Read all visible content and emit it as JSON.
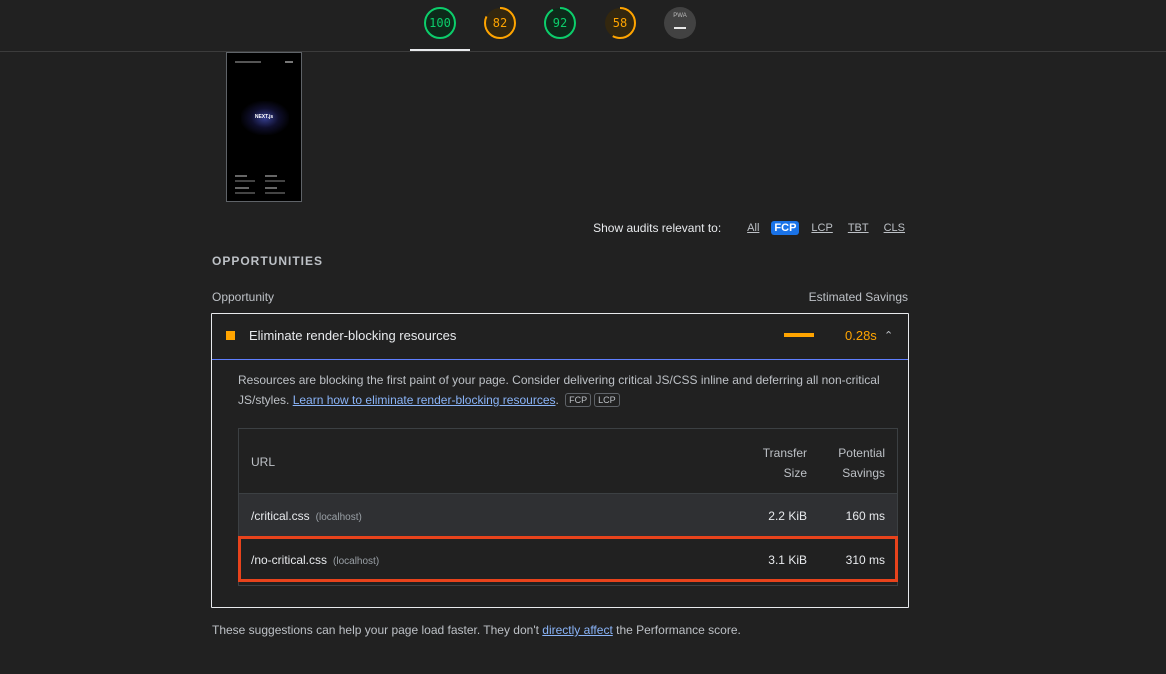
{
  "scores": [
    {
      "value": "100",
      "color": "#0cce6b",
      "percent": 100
    },
    {
      "value": "82",
      "color": "#ffa400",
      "percent": 82
    },
    {
      "value": "92",
      "color": "#0cce6b",
      "percent": 92
    },
    {
      "value": "58",
      "color": "#ffa400",
      "percent": 58
    },
    {
      "value": "PWA",
      "color": "#e8e8e8",
      "percent": 0
    }
  ],
  "thumbnail": {
    "logo_text": "NEXT.js"
  },
  "filter": {
    "label": "Show audits relevant to:",
    "options": [
      "All",
      "FCP",
      "LCP",
      "TBT",
      "CLS"
    ],
    "selected": "FCP"
  },
  "section": {
    "title": "OPPORTUNITIES",
    "col_opportunity": "Opportunity",
    "col_savings": "Estimated Savings"
  },
  "audit": {
    "title": "Eliminate render-blocking resources",
    "savings": "0.28s",
    "description": "Resources are blocking the first paint of your page. Consider delivering critical JS/CSS inline and deferring all non-critical JS/styles. ",
    "link_text": "Learn how to eliminate render-blocking resources",
    "tags": [
      "FCP",
      "LCP"
    ],
    "accent": "#ffa400",
    "table": {
      "headers": {
        "url": "URL",
        "transfer_1": "Transfer",
        "transfer_2": "Size",
        "savings_1": "Potential",
        "savings_2": "Savings"
      },
      "rows": [
        {
          "url": "/critical.css",
          "host": "(localhost)",
          "size": "2.2 KiB",
          "savings": "160 ms"
        },
        {
          "url": "/no-critical.css",
          "host": "(localhost)",
          "size": "3.1 KiB",
          "savings": "310 ms"
        }
      ]
    }
  },
  "footer": {
    "before": "These suggestions can help your page load faster. They don't ",
    "link": "directly affect",
    "after": " the Performance score."
  },
  "highlight_color": "#e8431c"
}
